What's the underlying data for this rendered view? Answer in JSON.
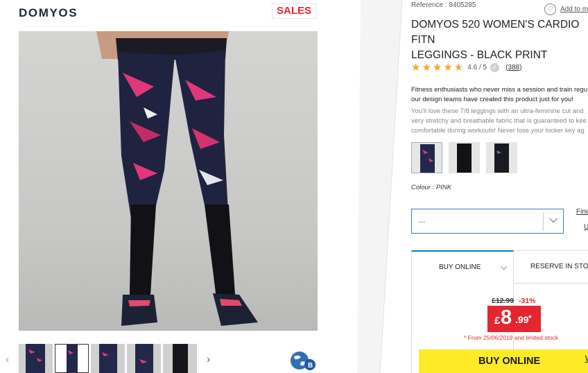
{
  "brand": {
    "logo_text": "DOMYOS",
    "sales_badge": "SALES"
  },
  "gallery": {
    "prev_arrow": "‹",
    "next_arrow": "›",
    "thumbnail_count": 5,
    "active_thumbnail": 2,
    "badge_icon": "globe-icon",
    "badge_letter": "B"
  },
  "product": {
    "reference": "Reference : 8405285",
    "title": "DOMYOS 520 WOMEN'S CARDIO FITN\nLEGGINGS - BLACK PRINT",
    "wishlist_label": "Add to m",
    "rating": {
      "stars": 4.6,
      "max": 5,
      "score_text": "4.6 / 5",
      "review_count": "(388)"
    },
    "description_lead": "Fitness enthusiasts who never miss a session and train regu our design teams have created this product just for you!",
    "description_body": "You'll love these 7/8 leggings with an ultra-feminine cut and very stretchy and breathable fabric that is guaranteed to kee comfortable during workouts! Never lose your locker key ag",
    "variants": [
      "pink-print",
      "black",
      "black-print"
    ],
    "selected_variant": 0,
    "colour_label": "Colour : PINK"
  },
  "size_selector": {
    "value": "...",
    "chevron": "⌵"
  },
  "links": {
    "find_size": "Find",
    "find_size_2": "U"
  },
  "tabs": {
    "buy_online": "BUY ONLINE",
    "reserve": "RESERVE IN STORE"
  },
  "pricing": {
    "old_price": "£12.99",
    "discount": "-31%",
    "currency": "£",
    "price_int": "8",
    "price_dec": ".99",
    "asterisk": "*",
    "promo_note": "* From 25/06/2019 and limited stock"
  },
  "buy_button": {
    "label": "BUY ONLINE"
  },
  "colors": {
    "accent_blue": "#0082c3",
    "sale_red": "#e3262f",
    "buy_yellow": "#ffea28",
    "star_gold": "#f5a623"
  }
}
